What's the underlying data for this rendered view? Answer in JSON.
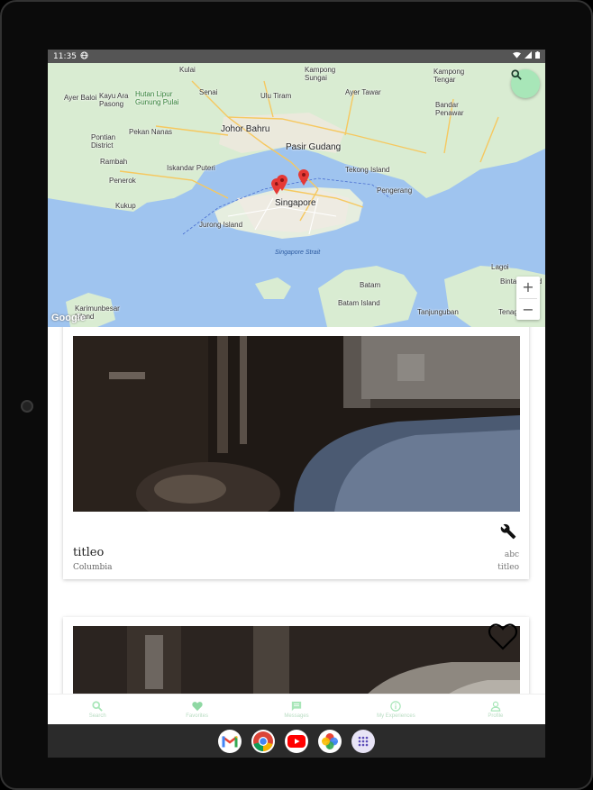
{
  "status_bar": {
    "time": "11:35"
  },
  "map": {
    "google_logo": "Google",
    "zoom_in": "+",
    "zoom_out": "−",
    "labels": {
      "kulai": "Kulai",
      "kampong_sungai": "Kampong\nSungai",
      "kampong_tengar": "Kampong\nTengar",
      "ayer_baloi": "Ayer Baloi",
      "kayu_ara_pasong": "Kayu Ara\nPasong",
      "hutan_lipur": "Hutan Lipur\nGunung Pulai",
      "senai": "Senai",
      "ulu_tiram": "Ulu Tiram",
      "ayer_tawar": "Ayer Tawar",
      "bandar_penawar": "Bandar\nPenawar",
      "pekan_nanas": "Pekan Nanas",
      "johor_bahru": "Johor Bahru",
      "pontian_district": "Pontian\nDistrict",
      "pasir_gudang": "Pasir Gudang",
      "rambah": "Rambah",
      "iskandar_puteri": "Iskandar Puteri",
      "tekong_island": "Tekong Island",
      "pengerang": "Pengerang",
      "penerok": "Penerok",
      "kukup": "Kukup",
      "singapore": "Singapore",
      "jurong_island": "Jurong Island",
      "singapore_strait": "Singapore Strait",
      "lagoi": "Lagoi",
      "bintan_island": "Bintan Island",
      "batam": "Batam",
      "karimunbesar": "Karimunbesar\nIsland",
      "batam_island": "Batam Island",
      "tanjungunban": "Tanjunguban",
      "tenaga": "Tenaga"
    }
  },
  "cards": [
    {
      "title": "titleo",
      "subtitle": "Columbia",
      "right_top": "abc",
      "right_bottom": "titleo"
    },
    {}
  ],
  "bottom_nav": [
    {
      "label": "Search",
      "icon": "search-icon"
    },
    {
      "label": "Favorites",
      "icon": "heart-icon"
    },
    {
      "label": "Messages",
      "icon": "chat-icon"
    },
    {
      "label": "My Experiences",
      "icon": "info-icon"
    },
    {
      "label": "Profile",
      "icon": "person-icon"
    }
  ],
  "dock": [
    {
      "app": "gmail-icon"
    },
    {
      "app": "chrome-icon"
    },
    {
      "app": "youtube-icon"
    },
    {
      "app": "photos-icon"
    },
    {
      "app": "app-drawer-icon"
    }
  ],
  "colors": {
    "accent_green": "#a8e6b8",
    "nav_label": "#b8dcc2",
    "map_water": "#9fc4ef",
    "map_land": "#d9ecd2",
    "pin_red": "#e53935"
  }
}
